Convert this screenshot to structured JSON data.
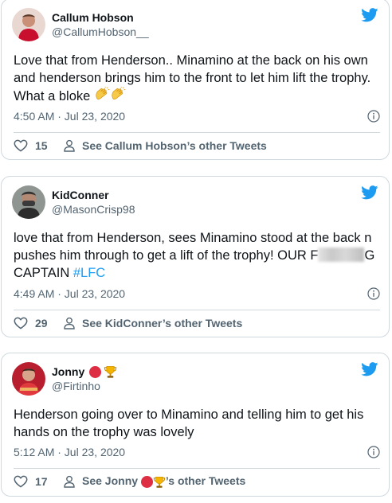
{
  "tweets": [
    {
      "name": "Callum Hobson",
      "handle": "@CallumHobson__",
      "text": "Love that from Henderson.. Minamino at the back on his own and henderson brings him to the front to let him lift the trophy. What a bloke ",
      "time": "4:50 AM · Jul 23, 2020",
      "likes": "15",
      "other_tweets": "See Callum Hobson’s other Tweets"
    },
    {
      "name": "KidConner",
      "handle": "@MasonCrisp98",
      "text_part1": "love that from Henderson, sees Minamino stood at the back n pushes him through to get a lift of the trophy! OUR F",
      "text_part2": "G CAPTAIN ",
      "hashtag": "#LFC",
      "time": "4:49 AM · Jul 23, 2020",
      "likes": "29",
      "other_tweets": "See KidConner’s other Tweets"
    },
    {
      "name": "Jonny",
      "handle": "@Firtinho",
      "text": "Henderson going over to Minamino and telling him to get his hands on the trophy was lovely",
      "time": "5:12 AM · Jul 23, 2020",
      "likes": "17",
      "other_prefix": "See Jonny ",
      "other_suffix": "’s other Tweets"
    }
  ],
  "icons": {
    "brand": "twitter-bird-icon",
    "info": "info-icon",
    "like": "heart-icon",
    "profile": "person-icon",
    "emoji_clap": "clapping-hands-emoji",
    "emoji_trophy": "trophy-emoji",
    "emoji_red_circle": "red-circle-emoji"
  },
  "colors": {
    "twitter_blue": "#1d9bf0",
    "text": "#0f1419",
    "muted": "#536471",
    "border": "#cfd9de"
  }
}
